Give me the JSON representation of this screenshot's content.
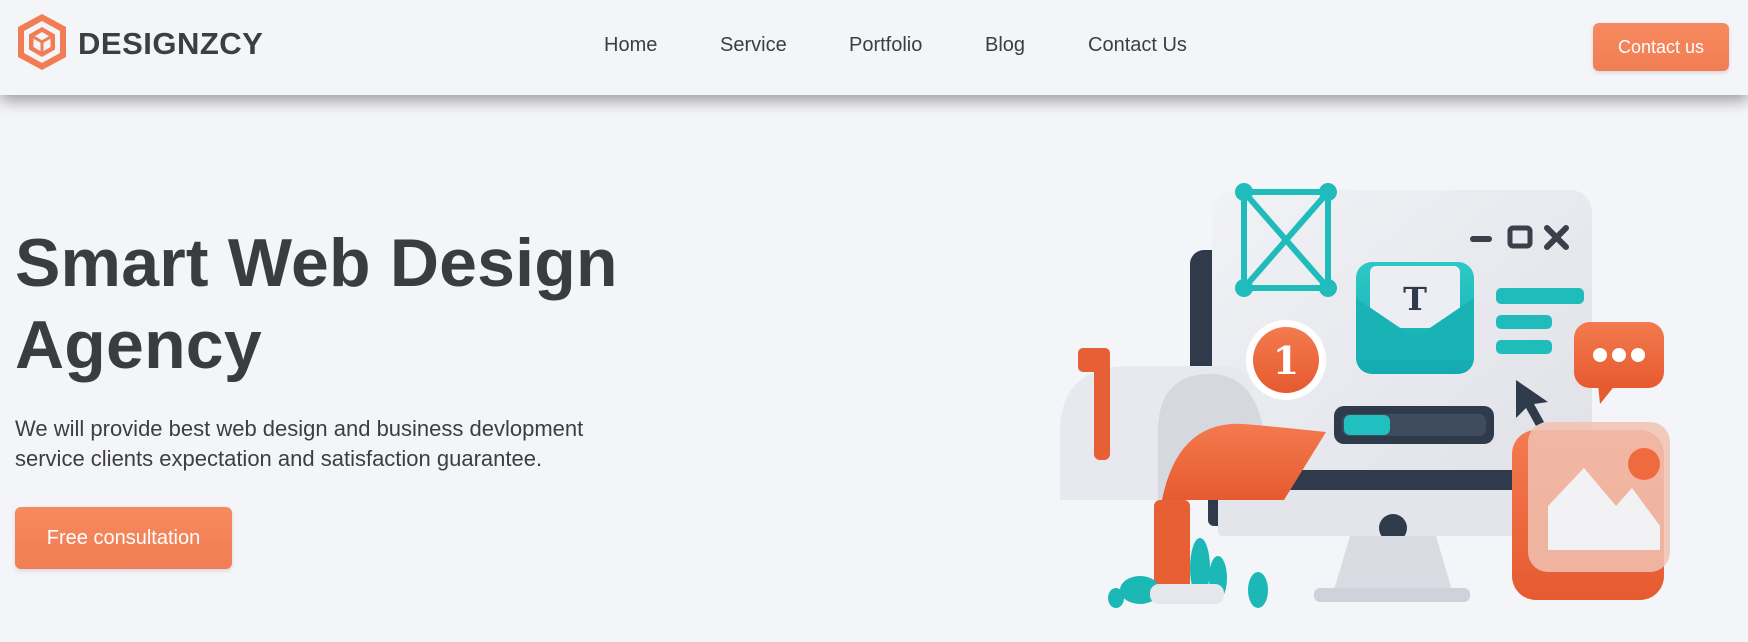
{
  "brand": {
    "name": "DESIGNZCY",
    "logo_icon": "hexagon-cube-logo",
    "accent_color": "#f27d54"
  },
  "nav": {
    "links": [
      {
        "label": "Home"
      },
      {
        "label": "Service"
      },
      {
        "label": "Portfolio"
      },
      {
        "label": "Blog"
      },
      {
        "label": "Contact Us"
      }
    ],
    "cta_label": "Contact us"
  },
  "hero": {
    "title_line1": "Smart Web Design",
    "title_line2": "Agency",
    "description_line1": "We will provide best web design and business devlopment",
    "description_line2": "service clients expectation and satisfaction guarantee.",
    "cta_label": "Free consultation",
    "illustration": {
      "icon": "web-design-3d-illustration",
      "notification_count": "1",
      "document_letter": "T",
      "window_controls": [
        "minimize",
        "maximize",
        "close"
      ],
      "colors": {
        "orange": "#ef6a3f",
        "teal": "#1fbdbd",
        "dark": "#2f3a4a",
        "light": "#e8e9ee"
      }
    }
  }
}
